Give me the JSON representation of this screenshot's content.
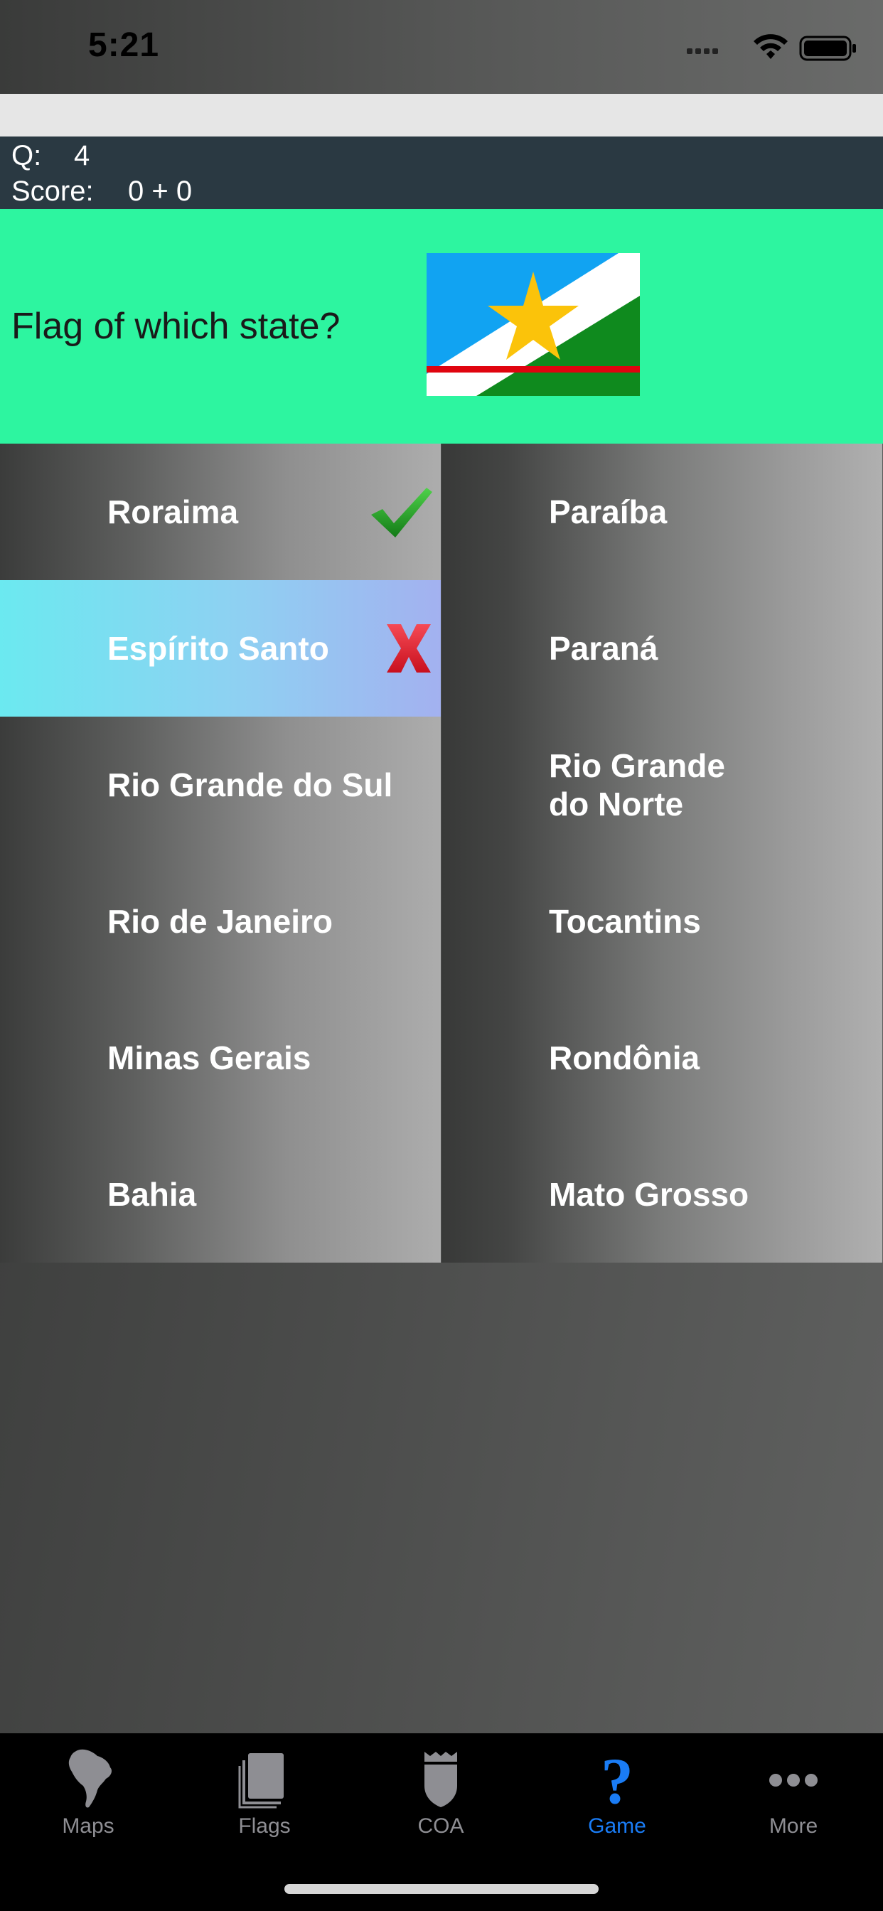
{
  "status_bar": {
    "time": "5:21"
  },
  "score": {
    "q_label": "Q:",
    "q_value": "4",
    "score_label": "Score:",
    "score_value": "0 + 0"
  },
  "question": {
    "text": "Flag of which state?",
    "flag_colors": {
      "blue": "#11a3f2",
      "white": "#ffffff",
      "green": "#0f8a1e",
      "red": "#e0040f",
      "gold": "#fbc30a"
    }
  },
  "answers": {
    "left": [
      {
        "label": "Roraima",
        "state": "correct"
      },
      {
        "label": "Espírito Santo",
        "state": "wrong"
      },
      {
        "label": "Rio Grande do Sul",
        "state": "none"
      },
      {
        "label": "Rio de Janeiro",
        "state": "none"
      },
      {
        "label": "Minas Gerais",
        "state": "none"
      },
      {
        "label": "Bahia",
        "state": "none"
      }
    ],
    "right": [
      {
        "label": "Paraíba",
        "state": "none"
      },
      {
        "label": "Paraná",
        "state": "none"
      },
      {
        "label": "Rio Grande do Norte",
        "state": "none"
      },
      {
        "label": "Tocantins",
        "state": "none"
      },
      {
        "label": "Rondônia",
        "state": "none"
      },
      {
        "label": "Mato Grosso",
        "state": "none"
      }
    ]
  },
  "tabs": [
    {
      "label": "Maps",
      "icon": "south-america-icon",
      "active": false
    },
    {
      "label": "Flags",
      "icon": "flags-icon",
      "active": false
    },
    {
      "label": "COA",
      "icon": "shield-icon",
      "active": false
    },
    {
      "label": "Game",
      "icon": "question-icon",
      "active": true
    },
    {
      "label": "More",
      "icon": "more-icon",
      "active": false
    }
  ],
  "colors": {
    "accent": "#1a7cf5",
    "question_bg": "#2df5a0",
    "score_bg": "#2a3942",
    "correct": "#1e9a22",
    "wrong": "#e8222f"
  }
}
